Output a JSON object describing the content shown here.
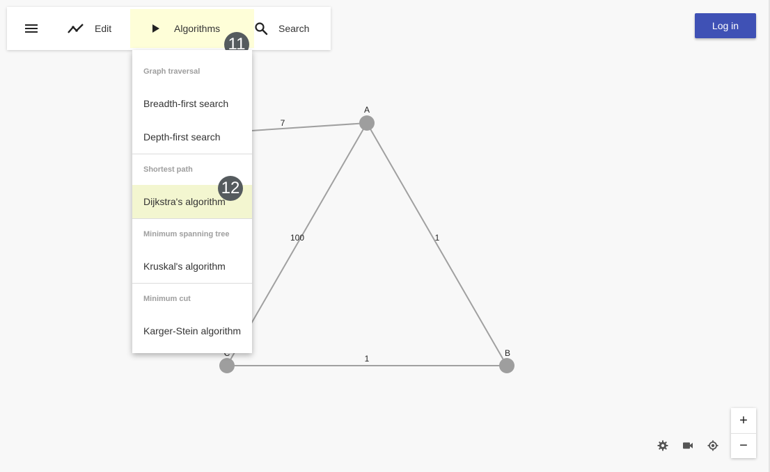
{
  "toolbar": {
    "menu_icon": "hamburger-menu-icon",
    "edit_label": "Edit",
    "edit_icon": "line-chart-icon",
    "algorithms_label": "Algorithms",
    "algorithms_icon": "play-icon",
    "search_label": "Search",
    "search_icon": "search-icon"
  },
  "login": {
    "label": "Log in",
    "color": "#3f51b5"
  },
  "badges": {
    "algorithms": "11",
    "dijkstra": "12"
  },
  "algorithms_menu": {
    "sections": [
      {
        "header": "Graph traversal",
        "items": [
          "Breadth-first search",
          "Depth-first search"
        ]
      },
      {
        "header": "Shortest path",
        "items": [
          "Dijkstra's algorithm"
        ]
      },
      {
        "header": "Minimum spanning tree",
        "items": [
          "Kruskal's algorithm"
        ]
      },
      {
        "header": "Minimum cut",
        "items": [
          "Karger-Stein algorithm"
        ]
      }
    ],
    "highlighted_item": "Dijkstra's algorithm",
    "highlight_color": "#f3f6d0"
  },
  "graph": {
    "nodes": [
      {
        "id": "A",
        "label": "A"
      },
      {
        "id": "B",
        "label": "B"
      },
      {
        "id": "C",
        "label": "C"
      }
    ],
    "edges": [
      {
        "from": "A",
        "to": "B",
        "weight": "1"
      },
      {
        "from": "C",
        "to": "B",
        "weight": "1"
      },
      {
        "from": "A",
        "to": "C",
        "weight": "100"
      },
      {
        "from": "A",
        "to": "hidden",
        "weight": "7"
      }
    ],
    "node_color": "#9e9e9e",
    "edge_color": "#a0a0a0"
  },
  "controls": {
    "zoom_in": "+",
    "zoom_out": "−",
    "icons": [
      "settings-icon",
      "camera-icon",
      "locate-icon"
    ]
  }
}
